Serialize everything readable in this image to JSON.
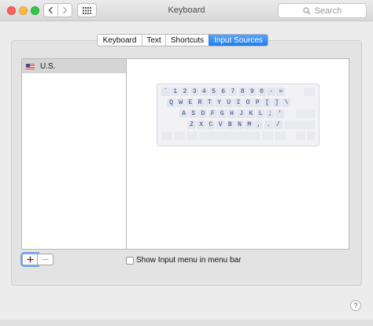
{
  "window": {
    "title": "Keyboard"
  },
  "search": {
    "placeholder": "Search",
    "icon": "magnifier-icon"
  },
  "tabs": [
    {
      "label": "Keyboard",
      "active": false
    },
    {
      "label": "Text",
      "active": false
    },
    {
      "label": "Shortcuts",
      "active": false
    },
    {
      "label": "Input Sources",
      "active": true
    }
  ],
  "sources": {
    "items": [
      {
        "label": "U.S.",
        "flag_icon": "us-flag-icon",
        "selected": true
      }
    ]
  },
  "keyboard_preview": {
    "rows": [
      [
        "`",
        "1",
        "2",
        "3",
        "4",
        "5",
        "6",
        "7",
        "8",
        "9",
        "0",
        "-",
        "="
      ],
      [
        "Q",
        "W",
        "E",
        "R",
        "T",
        "Y",
        "U",
        "I",
        "O",
        "P",
        "[",
        "]",
        "\\"
      ],
      [
        "A",
        "S",
        "D",
        "F",
        "G",
        "H",
        "J",
        "K",
        "L",
        ";",
        "'"
      ],
      [
        "Z",
        "X",
        "C",
        "V",
        "B",
        "N",
        "M",
        ",",
        ".",
        "/"
      ]
    ]
  },
  "buttons": {
    "add": "+",
    "remove": "−"
  },
  "options": {
    "show_input_menu": {
      "label": "Show Input menu in menu bar",
      "checked": false
    }
  },
  "help": {
    "label": "?"
  },
  "colors": {
    "accent": "#1d7cf1",
    "key_text": "#2e3e85"
  }
}
